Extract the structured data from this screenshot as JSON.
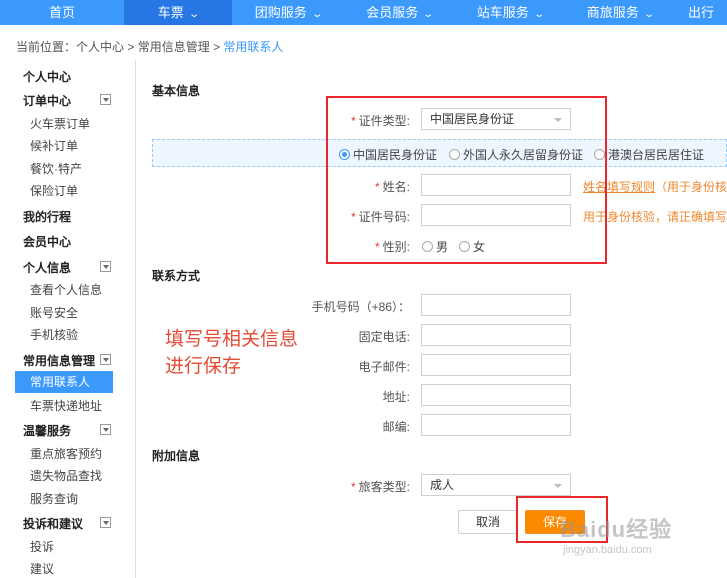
{
  "topnav": {
    "items": [
      {
        "label": "首页",
        "dropdown": false,
        "active": false
      },
      {
        "label": "车票",
        "dropdown": true,
        "active": true
      },
      {
        "label": "团购服务",
        "dropdown": true,
        "active": false
      },
      {
        "label": "会员服务",
        "dropdown": true,
        "active": false
      },
      {
        "label": "站车服务",
        "dropdown": true,
        "active": false
      },
      {
        "label": "商旅服务",
        "dropdown": true,
        "active": false
      },
      {
        "label": "出行",
        "dropdown": false,
        "active": false
      }
    ],
    "chevron": "⌄"
  },
  "breadcrumb": {
    "prefix": "当前位置：",
    "items": [
      "个人中心",
      "常用信息管理",
      "常用联系人"
    ],
    "separator": " > "
  },
  "sidebar": {
    "groups": [
      {
        "label": "个人中心",
        "collapsible": false,
        "items": []
      },
      {
        "label": "订单中心",
        "collapsible": true,
        "items": [
          "火车票订单",
          "候补订单",
          "餐饮·特产",
          "保险订单"
        ]
      },
      {
        "label": "我的行程",
        "collapsible": false,
        "items": []
      },
      {
        "label": "会员中心",
        "collapsible": false,
        "items": []
      },
      {
        "label": "个人信息",
        "collapsible": true,
        "items": [
          "查看个人信息",
          "账号安全",
          "手机核验"
        ]
      },
      {
        "label": "常用信息管理",
        "collapsible": true,
        "items": [
          "常用联系人",
          "车票快递地址"
        ]
      },
      {
        "label": "温馨服务",
        "collapsible": true,
        "items": [
          "重点旅客预约",
          "遗失物品查找",
          "服务查询"
        ]
      },
      {
        "label": "投诉和建议",
        "collapsible": true,
        "items": [
          "投诉",
          "建议"
        ]
      }
    ],
    "active_item": "常用联系人"
  },
  "form": {
    "basic_title": "基本信息",
    "required_mark": "*",
    "id_type": {
      "label": "证件类型:",
      "value": "中国居民身份证"
    },
    "id_options": [
      {
        "label": "中国居民身份证",
        "checked": true
      },
      {
        "label": "外国人永久居留身份证",
        "checked": false
      },
      {
        "label": "港澳台居民居住证",
        "checked": false
      }
    ],
    "name": {
      "label": "姓名:",
      "value": "",
      "hint_link": "姓名填写规则",
      "hint_text": "（用于身份核"
    },
    "id_number": {
      "label": "证件号码:",
      "value": "",
      "hint_text": "用于身份核验，请正确填写"
    },
    "gender": {
      "label": "性别:",
      "options": [
        "男",
        "女"
      ]
    },
    "contact_title": "联系方式",
    "contact_fields": [
      {
        "label": "手机号码（+86）：",
        "value": ""
      },
      {
        "label": "固定电话:",
        "value": ""
      },
      {
        "label": "电子邮件:",
        "value": ""
      },
      {
        "label": "地址:",
        "value": ""
      },
      {
        "label": "邮编:",
        "value": ""
      }
    ],
    "extra_title": "附加信息",
    "passenger_type": {
      "label": "旅客类型:",
      "value": "成人"
    },
    "cancel_label": "取消",
    "save_label": "保存"
  },
  "annotation": {
    "line1": "填写号相关信息",
    "line2": "进行保存"
  },
  "watermark": {
    "brand": "Baidu经验",
    "url": "jingyan.baidu.com"
  },
  "colors": {
    "nav_bg": "#3b99fc",
    "nav_active": "#2676e3",
    "accent": "#3b99fc",
    "save_button": "#fb8a00",
    "hint": "#f0872e",
    "highlight_box": "#e8262b",
    "annotation": "#e34b35"
  }
}
